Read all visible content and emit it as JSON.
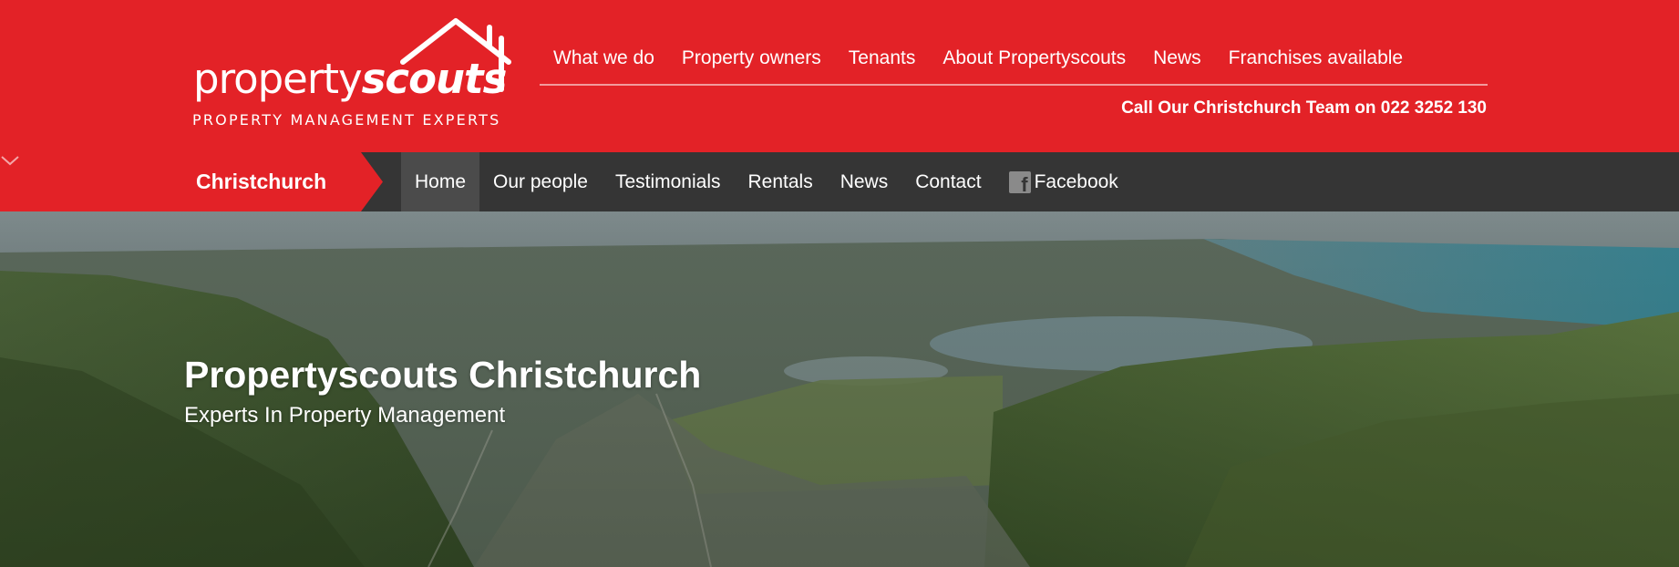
{
  "brand": {
    "name_part1": "property",
    "name_part2": "scouts",
    "tagline": "PROPERTY MANAGEMENT EXPERTS"
  },
  "main_nav": {
    "items": [
      {
        "label": "What we do"
      },
      {
        "label": "Property owners"
      },
      {
        "label": "Tenants"
      },
      {
        "label": "About Propertyscouts"
      },
      {
        "label": "News"
      },
      {
        "label": "Franchises available"
      }
    ],
    "call_text": "Call Our Christchurch Team on 022 3252 130"
  },
  "sub_nav": {
    "location": "Christchurch",
    "items": [
      {
        "label": "Home",
        "active": true
      },
      {
        "label": "Our people"
      },
      {
        "label": "Testimonials"
      },
      {
        "label": "Rentals"
      },
      {
        "label": "News"
      },
      {
        "label": "Contact"
      },
      {
        "label": "Facebook",
        "icon": "facebook-icon"
      }
    ]
  },
  "hero": {
    "title": "Propertyscouts Christchurch",
    "subtitle": "Experts In Property Management"
  },
  "colors": {
    "brand_red": "#e32227",
    "subnav_bg": "#353535",
    "subnav_active": "#4b4b4b"
  }
}
